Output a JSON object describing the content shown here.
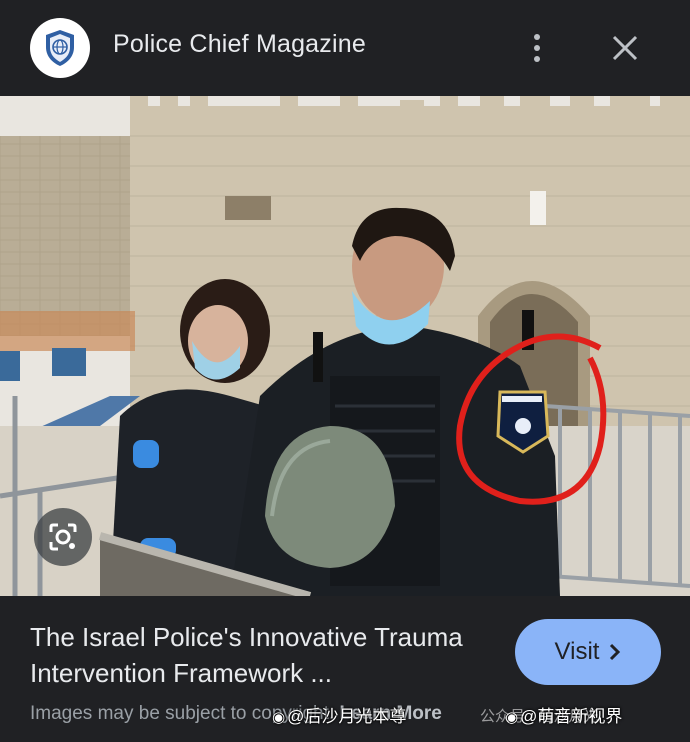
{
  "header": {
    "site_name": "Police Chief Magazine",
    "logo_icon": "shield-globe-logo",
    "more_icon": "more-vertical-icon",
    "close_icon": "close-icon"
  },
  "result": {
    "title": "The Israel Police's Innovative Trauma Intervention Framework ...",
    "visit_label": "Visit",
    "visit_icon": "chevron-right-icon",
    "disclaimer": "Images may be subject to copyright.",
    "learn_more": "Learn More"
  },
  "lens": {
    "icon": "lens-search-icon"
  },
  "watermark": {
    "left_text": "@后沙月光本尊",
    "right_text": "@萌音新视界",
    "overlay_text": "公众号 · 后沙月光"
  },
  "colors": {
    "background": "#202124",
    "visit_button": "#8ab4f8",
    "annotation_circle": "#e0201b"
  }
}
